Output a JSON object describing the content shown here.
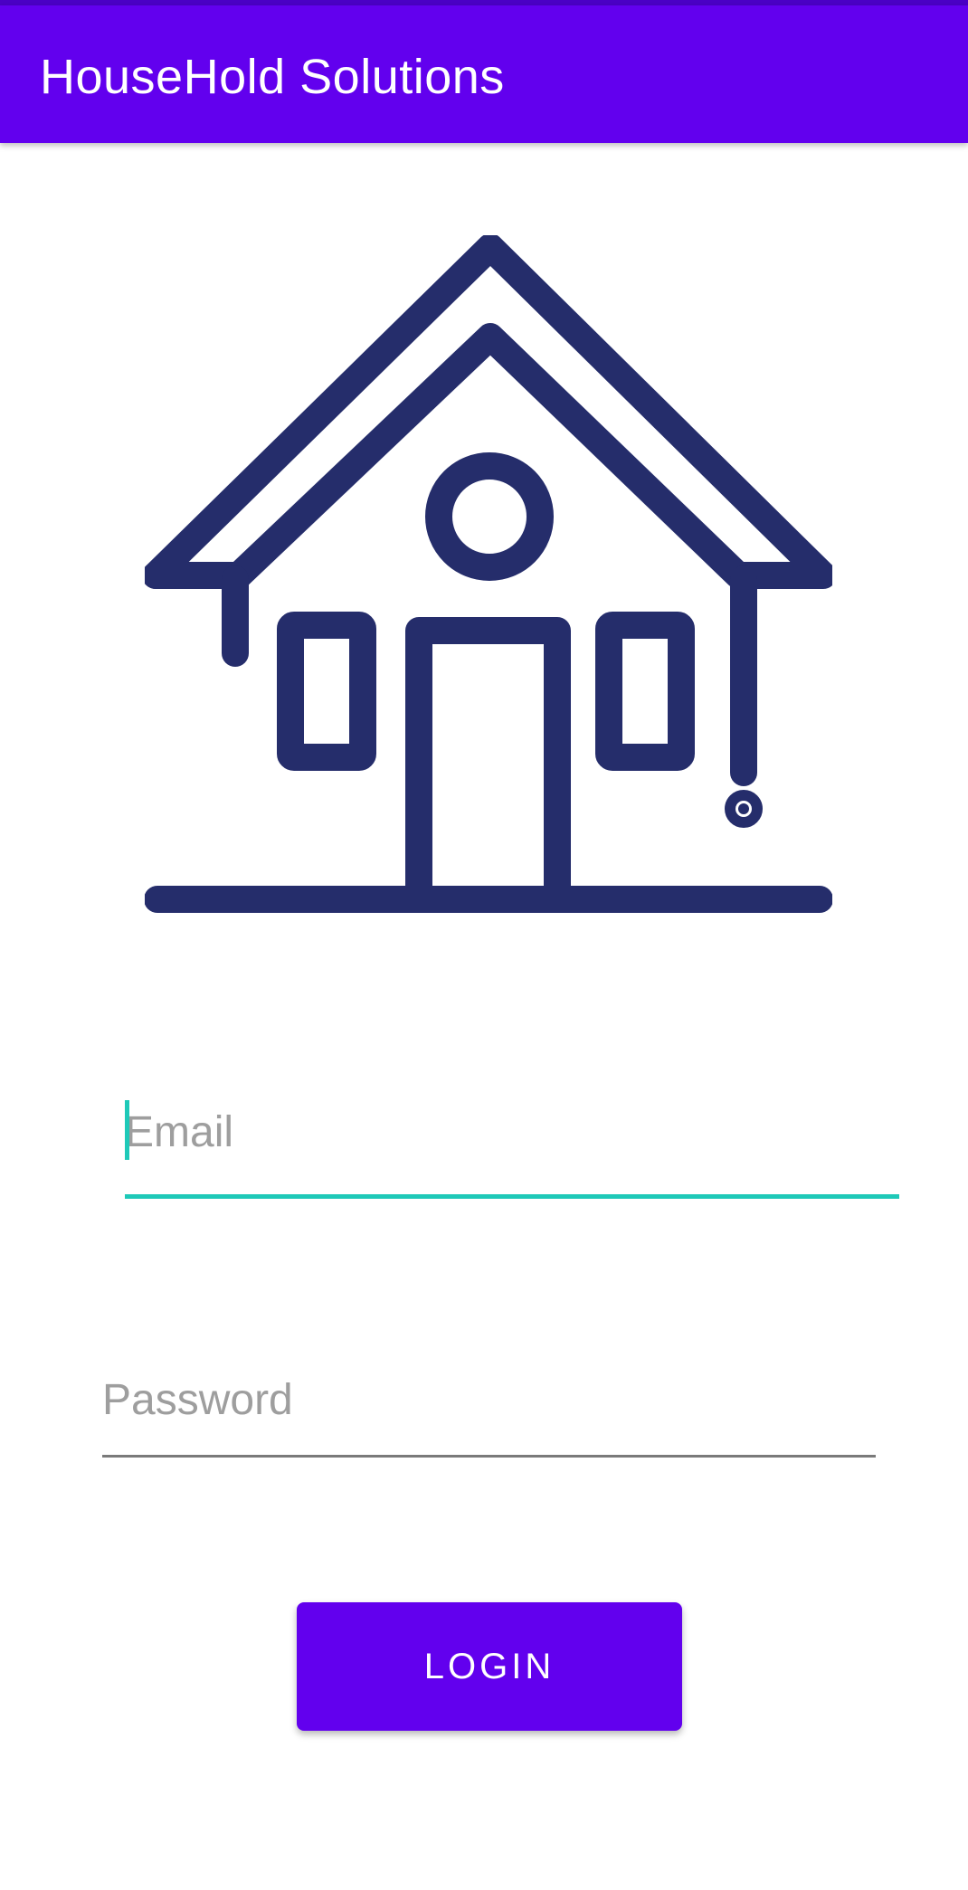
{
  "app": {
    "title": "HouseHold Solutions"
  },
  "logo": {
    "icon": "house-icon",
    "color": "#252d6b"
  },
  "form": {
    "email": {
      "placeholder": "Email",
      "value": "",
      "focused": true
    },
    "password": {
      "placeholder": "Password",
      "value": ""
    },
    "login_label": "LOGIN"
  },
  "colors": {
    "primary": "#6200ee",
    "accent": "#1ec9b8",
    "status_bar": "#4a00c4"
  }
}
